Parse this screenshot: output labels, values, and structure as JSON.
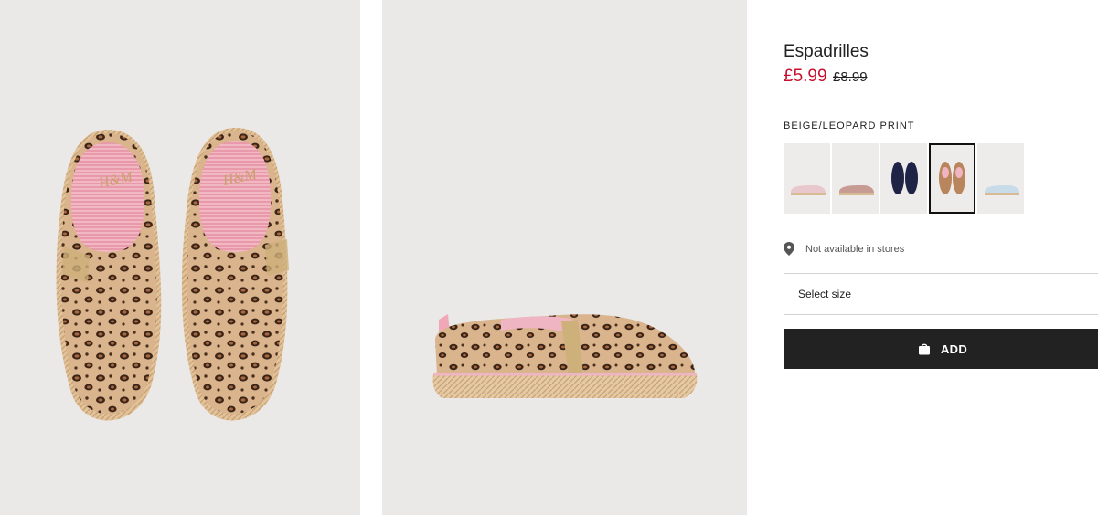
{
  "product": {
    "title": "Espadrilles",
    "price": "£5.99",
    "old_price": "£8.99",
    "color_name": "BEIGE/LEOPARD PRINT",
    "store_availability": "Not available in stores",
    "size_placeholder": "Select size",
    "add_label": "ADD"
  },
  "gallery": [
    {
      "view": "top",
      "icon": "espadrille-pair-top-view"
    },
    {
      "view": "side",
      "icon": "espadrille-side-view"
    }
  ],
  "swatches": [
    {
      "name": "pink floral",
      "color": "#e8c8cc",
      "selected": false
    },
    {
      "name": "pink",
      "color": "#c89a94",
      "selected": false
    },
    {
      "name": "navy",
      "color": "#1f2447",
      "selected": false
    },
    {
      "name": "beige/leopard print",
      "color": "#b9855c",
      "selected": true
    },
    {
      "name": "light blue print",
      "color": "#c7dbe9",
      "selected": false
    }
  ],
  "colors": {
    "price_red": "#c8102e",
    "button_black": "#222222",
    "photo_bg": "#ebe9e7"
  }
}
